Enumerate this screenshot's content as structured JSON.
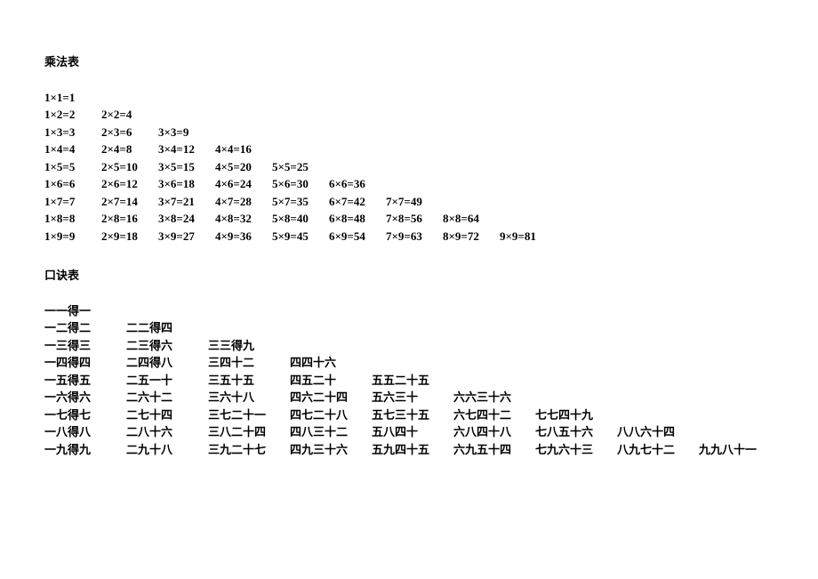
{
  "title1": "乘法表",
  "title2": "口诀表",
  "mult": [
    [
      "1×1=1"
    ],
    [
      "1×2=2",
      "2×2=4"
    ],
    [
      "1×3=3",
      "2×3=6",
      "3×3=9"
    ],
    [
      "1×4=4",
      "2×4=8",
      "3×4=12",
      "4×4=16"
    ],
    [
      "1×5=5",
      "2×5=10",
      "3×5=15",
      "4×5=20",
      "5×5=25"
    ],
    [
      "1×6=6",
      "2×6=12",
      "3×6=18",
      "4×6=24",
      "5×6=30",
      "6×6=36"
    ],
    [
      "1×7=7",
      "2×7=14",
      "3×7=21",
      "4×7=28",
      "5×7=35",
      "6×7=42",
      "7×7=49"
    ],
    [
      "1×8=8",
      "2×8=16",
      "3×8=24",
      "4×8=32",
      "5×8=40",
      "6×8=48",
      "7×8=56",
      "8×8=64"
    ],
    [
      "1×9=9",
      "2×9=18",
      "3×9=27",
      "4×9=36",
      "5×9=45",
      "6×9=54",
      "7×9=63",
      "8×9=72",
      "9×9=81"
    ]
  ],
  "koujue": [
    [
      "一一得一"
    ],
    [
      "一二得二",
      "二二得四"
    ],
    [
      "一三得三",
      "二三得六",
      "三三得九"
    ],
    [
      "一四得四",
      "二四得八",
      "三四十二",
      "四四十六"
    ],
    [
      "一五得五",
      "二五一十",
      "三五十五",
      "四五二十",
      "五五二十五"
    ],
    [
      "一六得六",
      "二六十二",
      "三六十八",
      "四六二十四",
      "五六三十",
      "六六三十六"
    ],
    [
      "一七得七",
      "二七十四",
      "三七二十一",
      "四七二十八",
      "五七三十五",
      "六七四十二",
      "七七四十九"
    ],
    [
      "一八得八",
      "二八十六",
      "三八二十四",
      "四八三十二",
      "五八四十",
      "六八四十八",
      "七八五十六",
      "八八六十四"
    ],
    [
      "一九得九",
      "二九十八",
      "三九二十七",
      "四九三十六",
      "五九四十五",
      "六九五十四",
      "七九六十三",
      "八九七十二",
      "九九八十一"
    ]
  ]
}
